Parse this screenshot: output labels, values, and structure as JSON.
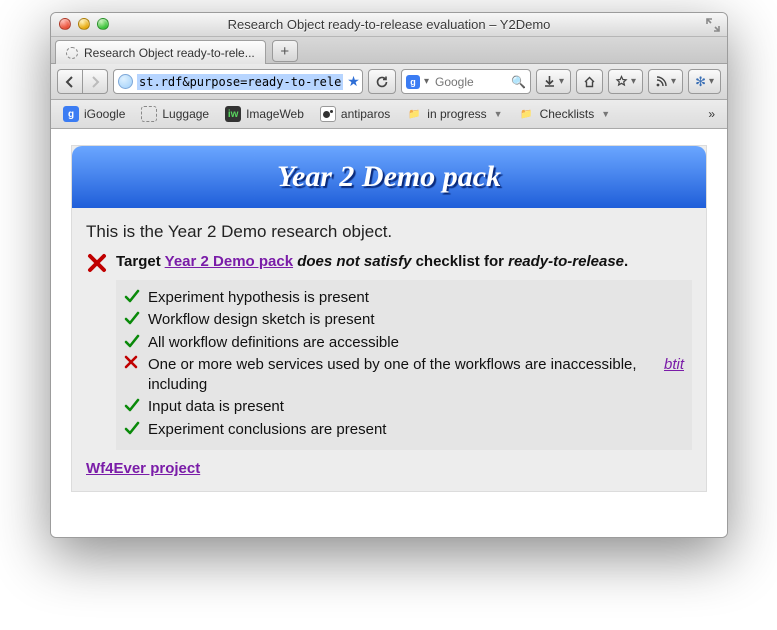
{
  "window": {
    "title": "Research Object ready-to-release evaluation – Y2Demo"
  },
  "tab": {
    "title": "Research Object ready-to-rele..."
  },
  "url": {
    "visible": "st.rdf&purpose=ready-to-rele"
  },
  "search": {
    "engine_initial": "g",
    "placeholder": "Google"
  },
  "newtab": {
    "label": "+"
  },
  "bookmarks": [
    {
      "label": "iGoogle"
    },
    {
      "label": "Luggage"
    },
    {
      "label": "ImageWeb"
    },
    {
      "label": "antiparos"
    },
    {
      "label": "in progress"
    },
    {
      "label": "Checklists"
    }
  ],
  "overflow_label": "»",
  "page": {
    "banner_title": "Year 2 Demo pack",
    "description": "This is the Year 2 Demo research object.",
    "result_prefix": "Target ",
    "result_link": "Year 2 Demo pack",
    "result_mid": " does not satisfy",
    "result_suffix": " checklist for ",
    "result_purpose": "ready-to-release",
    "result_dot": ".",
    "checks": [
      {
        "pass": true,
        "text": "Experiment hypothesis is present"
      },
      {
        "pass": true,
        "text": "Workflow design sketch is present"
      },
      {
        "pass": true,
        "text": "All workflow definitions are accessible"
      },
      {
        "pass": false,
        "text": "One or more web services used by one of the workflows are inaccessible, including ",
        "link": "btit"
      },
      {
        "pass": true,
        "text": "Input data is present"
      },
      {
        "pass": true,
        "text": "Experiment conclusions are present"
      }
    ],
    "footer_link": "Wf4Ever project"
  }
}
